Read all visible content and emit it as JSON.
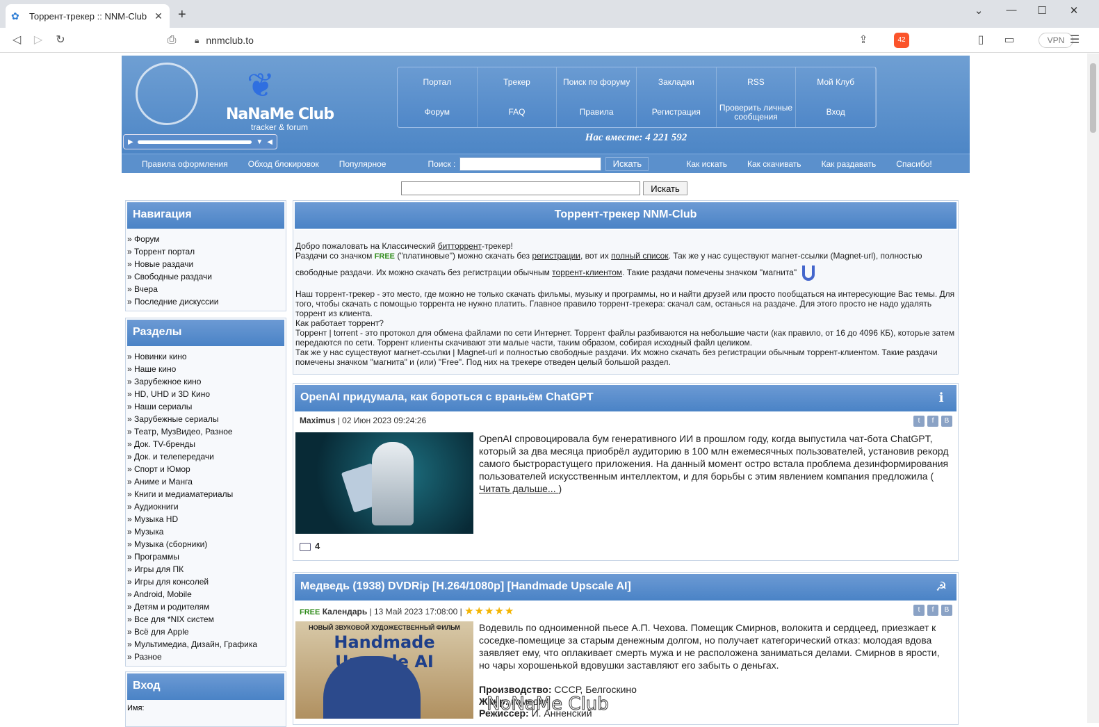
{
  "browser": {
    "tab_title": "Торрент-трекер :: NNM-Club",
    "url": "nnmclub.to",
    "vpn_label": "VPN",
    "brave_badge": "42"
  },
  "site": {
    "logo_text": "NaNaMe Club",
    "logo_sub": "tracker & forum",
    "nav": [
      "Портал",
      "Трекер",
      "Поиск по форуму",
      "Закладки",
      "RSS",
      "Мой Клуб",
      "Форум",
      "FAQ",
      "Правила",
      "Регистрация",
      "Проверить личные сообщения",
      "Вход"
    ],
    "together": "Нас вместе: 4 221 592",
    "subbar": {
      "links_left": [
        "Правила оформления",
        "Обход блокировок",
        "Популярное"
      ],
      "search_label": "Поиск :",
      "search_button": "Искать",
      "links_right": [
        "Как искать",
        "Как скачивать",
        "Как раздавать",
        "Спасибо!"
      ]
    },
    "search2_button": "Искать"
  },
  "sidebar": {
    "nav_title": "Навигация",
    "nav_items": [
      "Форум",
      "Торрент портал",
      "Новые раздачи",
      "Свободные раздачи",
      "Вчера",
      "Последние дискуссии"
    ],
    "sections_title": "Разделы",
    "sections": [
      "Новинки кино",
      "Наше кино",
      "Зарубежное кино",
      "HD, UHD и 3D Кино",
      "Наши сериалы",
      "Зарубежные сериалы",
      "Театр, МузВидео, Разное",
      "Док. TV-бренды",
      "Док. и телепередачи",
      "Спорт и Юмор",
      "Аниме и Манга",
      "Книги и медиаматериалы",
      "Аудиокниги",
      "Музыка HD",
      "Музыка",
      "Музыка (сборники)",
      "Программы",
      "Игры для ПК",
      "Игры для консолей",
      "Android, Mobile",
      "Детям и родителям",
      "Все для *NIX систем",
      "Всё для Apple",
      "Мультимедиа, Дизайн, Графика",
      "Разное"
    ],
    "login_title": "Вход",
    "login_name_label": "Имя:"
  },
  "welcome": {
    "title": "Торрент-трекер NNM-Club",
    "p1a": "Добро пожаловать на Классический ",
    "p1link": "битторрент",
    "p1b": "-трекер!",
    "p2a": "Раздачи со значком ",
    "free": "FREE",
    "p2b": " (\"платиновые\") можно скачать без ",
    "p2link1": "регистрации",
    "p2c": ", вот их ",
    "p2link2": "полный список",
    "p2d": ". Так же у нас существуют магнет-ссылки (Magnet-url), полностью",
    "p3a": "свободные раздачи. Их можно скачать без регистрации обычным ",
    "p3link": "торрент-клиентом",
    "p3b": ". Такие раздачи помечены значком \"магнита\"",
    "p4": "Наш торрент-трекер - это место, где можно не только скачать фильмы, музыку и программы, но и найти друзей или просто пообщаться на интересующие Вас темы. Для того, чтобы скачать с помощью торрента не нужно платить. Главное правило торрент-трекера: скачал сам, останься на раздаче. Для этого просто не надо удалять торрент из клиента.",
    "p5": "Как работает торрент?",
    "p6": "Торрент | torrent - это протокол для обмена файлами по сети Интернет. Торрент файлы разбиваются на небольшие части (как правило, от 16 до 4096 КБ), которые затем передаются по сети. Торрент клиенты скачивают эти малые части, таким образом, собирая исходный файл целиком.",
    "p7": "Так же у нас существуют магнет-ссылки | Magnet-url и полностью свободные раздачи. Их можно скачать без регистрации обычным торрент-клиентом. Такие раздачи помечены значком \"магнита\" и (или) \"Free\". Под них на трекере отведен целый большой раздел."
  },
  "news1": {
    "title": "OpenAI придумала, как бороться с враньём ChatGPT",
    "author": "Maximus",
    "date": " | 02 Июн 2023 09:24:26",
    "text": "OpenAI спровоцировала бум генеративного ИИ в прошлом году, когда выпустила чат-бота ChatGPT, который за два месяца приобрёл аудиторию в 100 млн ежемесячных пользователей, установив рекорд самого быстрорастущего приложения. На данный момент остро встала проблема дезинформирования пользователей искусственным интеллектом, и для борьбы с этим явлением компания предложила (",
    "read_more": "Читать дальше... ",
    "close_paren": ")",
    "comments": "4"
  },
  "news2": {
    "title": "Медведь (1938) DVDRip [H.264/1080p] [Handmade Upscale AI]",
    "free": "FREE",
    "author": "Календарь",
    "date": " | 13 Май 2023 17:08:00 | ",
    "stars": "★★★★★",
    "text": "Водевиль по одноименной пьесе А.П. Чехова. Помещик Смирнов, волокита и сердцеед, приезжает к соседке-помещице за старым денежным долгом, но получает категорический отказ: молодая вдова заявляет ему, что оплакивает смерть мужа и не расположена заниматься делами. Смирнов в ярости, но чары хорошенькой вдовушки заставляют его забыть о деньгах.",
    "prod_label": "Производство:",
    "prod_value": " СССР, Белгоскино",
    "genre_label": "Жанр:",
    "genre_value": " комедия",
    "director_label": "Режиссер:",
    "director_value": " И. Анненский",
    "poster_top": "НОВЫЙ ЗВУКОВОЙ ХУДОЖЕСТВЕННЫЙ ФИЛЬМ",
    "poster_title": "Handmade Upscale AI"
  },
  "watermark": "NoNaMe Club"
}
